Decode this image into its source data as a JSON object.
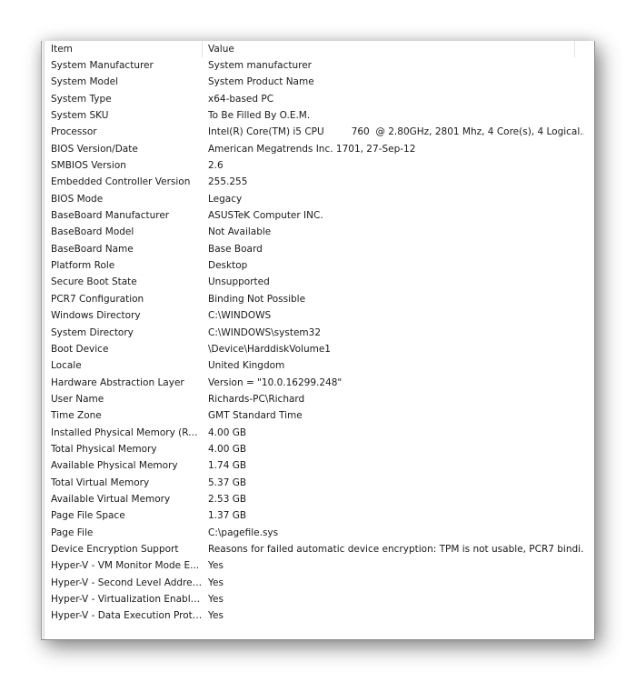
{
  "columns": {
    "item": "Item",
    "value": "Value"
  },
  "rows": [
    {
      "item": "System Manufacturer",
      "value": "System manufacturer"
    },
    {
      "item": "System Model",
      "value": "System Product Name"
    },
    {
      "item": "System Type",
      "value": "x64-based PC"
    },
    {
      "item": "System SKU",
      "value": "To Be Filled By O.E.M."
    },
    {
      "item": "Processor",
      "value": "Intel(R) Core(TM) i5 CPU         760  @ 2.80GHz, 2801 Mhz, 4 Core(s), 4 Logical..."
    },
    {
      "item": "BIOS Version/Date",
      "value": "American Megatrends Inc. 1701, 27-Sep-12"
    },
    {
      "item": "SMBIOS Version",
      "value": "2.6"
    },
    {
      "item": "Embedded Controller Version",
      "value": "255.255"
    },
    {
      "item": "BIOS Mode",
      "value": "Legacy"
    },
    {
      "item": "BaseBoard Manufacturer",
      "value": "ASUSTeK Computer INC."
    },
    {
      "item": "BaseBoard Model",
      "value": "Not Available"
    },
    {
      "item": "BaseBoard Name",
      "value": "Base Board"
    },
    {
      "item": "Platform Role",
      "value": "Desktop"
    },
    {
      "item": "Secure Boot State",
      "value": "Unsupported"
    },
    {
      "item": "PCR7 Configuration",
      "value": "Binding Not Possible"
    },
    {
      "item": "Windows Directory",
      "value": "C:\\WINDOWS"
    },
    {
      "item": "System Directory",
      "value": "C:\\WINDOWS\\system32"
    },
    {
      "item": "Boot Device",
      "value": "\\Device\\HarddiskVolume1"
    },
    {
      "item": "Locale",
      "value": "United Kingdom"
    },
    {
      "item": "Hardware Abstraction Layer",
      "value": "Version = \"10.0.16299.248\""
    },
    {
      "item": "User Name",
      "value": "Richards-PC\\Richard"
    },
    {
      "item": "Time Zone",
      "value": "GMT Standard Time"
    },
    {
      "item": "Installed Physical Memory (RAM)",
      "value": "4.00 GB"
    },
    {
      "item": "Total Physical Memory",
      "value": "4.00 GB"
    },
    {
      "item": "Available Physical Memory",
      "value": "1.74 GB"
    },
    {
      "item": "Total Virtual Memory",
      "value": "5.37 GB"
    },
    {
      "item": "Available Virtual Memory",
      "value": "2.53 GB"
    },
    {
      "item": "Page File Space",
      "value": "1.37 GB"
    },
    {
      "item": "Page File",
      "value": "C:\\pagefile.sys"
    },
    {
      "item": "Device Encryption Support",
      "value": "Reasons for failed automatic device encryption: TPM is not usable, PCR7 bindi..."
    },
    {
      "item": "Hyper-V - VM Monitor Mode E...",
      "value": "Yes"
    },
    {
      "item": "Hyper-V - Second Level Addres...",
      "value": "Yes"
    },
    {
      "item": "Hyper-V - Virtualization Enable...",
      "value": "Yes"
    },
    {
      "item": "Hyper-V - Data Execution Prote...",
      "value": "Yes"
    }
  ]
}
